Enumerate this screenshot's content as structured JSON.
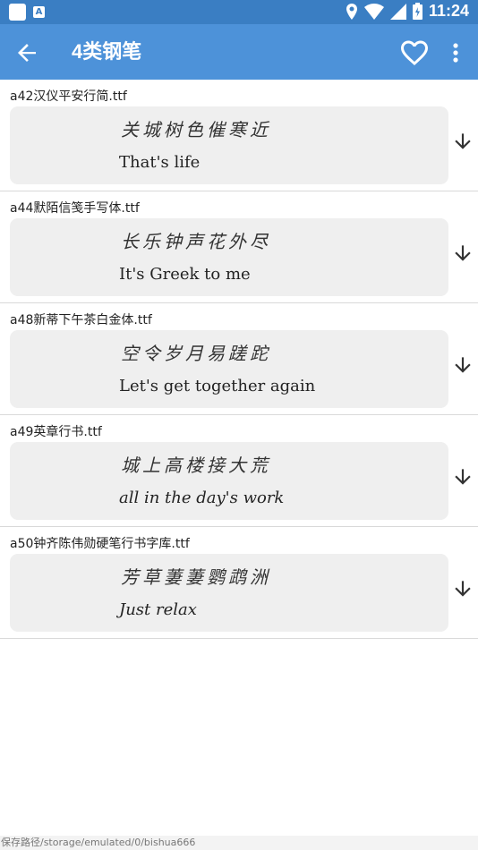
{
  "status_bar": {
    "time": "11:24",
    "icons": [
      "app-notification-icon",
      "text-notification-icon",
      "location-icon",
      "wifi-icon",
      "signal-icon",
      "battery-icon"
    ]
  },
  "app_bar": {
    "title": "4类钢笔",
    "back_icon": "arrow-back-icon",
    "favorite_icon": "heart-outline-icon",
    "more_icon": "more-vert-icon"
  },
  "fonts": [
    {
      "name": "a42汉仪平安行简.ttf",
      "preview_cn": "关城树色催寒近",
      "preview_en": "That's  life"
    },
    {
      "name": "a44默陌信笺手写体.ttf",
      "preview_cn": "长乐钟声花外尽",
      "preview_en": "It's Greek to me"
    },
    {
      "name": "a48新蒂下午茶白金体.ttf",
      "preview_cn": "空令岁月易蹉跎",
      "preview_en": "Let's get together again"
    },
    {
      "name": "a49英章行书.ttf",
      "preview_cn": "城上高楼接大荒",
      "preview_en": "all in the day's work"
    },
    {
      "name": "a50钟齐陈伟勋硬笔行书字库.ttf",
      "preview_cn": "芳草萋萋鹦鹉洲",
      "preview_en": "Just  relax"
    }
  ],
  "footer": {
    "save_path": "保存路径/storage/emulated/0/bishua666"
  },
  "colors": {
    "status_bar": "#3a7ec3",
    "app_bar": "#4d92d9",
    "card": "#efefef"
  }
}
